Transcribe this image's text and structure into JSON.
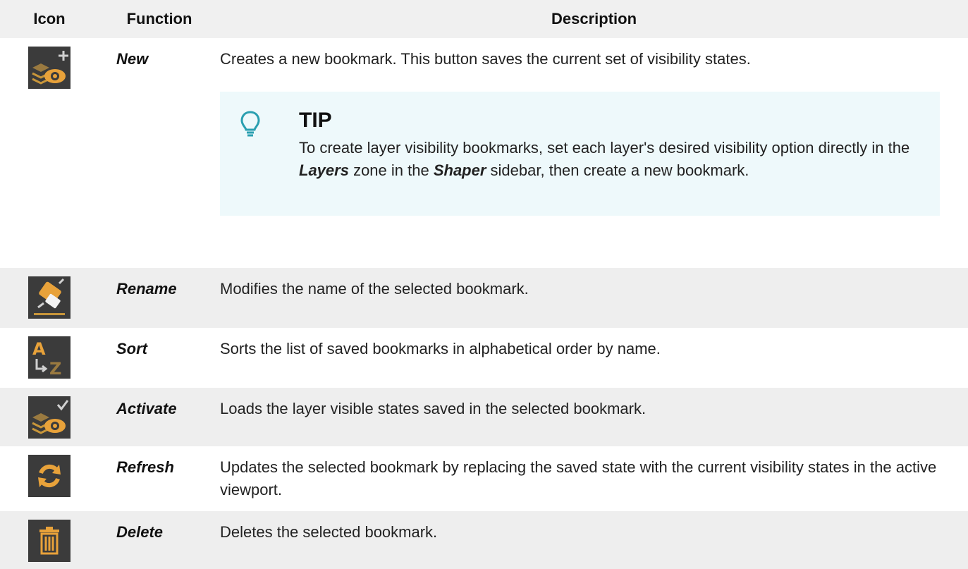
{
  "headers": {
    "icon": "Icon",
    "function": "Function",
    "description": "Description"
  },
  "colors": {
    "icon_bg": "#3b3b3b",
    "icon_accent": "#e0a030",
    "tip_bg": "#eef9fb",
    "tip_icon": "#2a9fb0"
  },
  "rows": [
    {
      "icon": "new-bookmark-icon",
      "function": "New",
      "description": "Creates a new bookmark. This button saves the current set of visibility states."
    },
    {
      "icon": "rename-icon",
      "function": "Rename",
      "description": "Modifies the name of the selected bookmark."
    },
    {
      "icon": "sort-az-icon",
      "function": "Sort",
      "description": "Sorts the list of saved bookmarks in alphabetical order by name."
    },
    {
      "icon": "activate-bookmark-icon",
      "function": "Activate",
      "description": "Loads the layer visible states saved in the selected bookmark."
    },
    {
      "icon": "refresh-icon",
      "function": "Refresh",
      "description": "Updates the selected bookmark by replacing the saved state with the current visibility states in the active viewport."
    },
    {
      "icon": "trash-icon",
      "function": "Delete",
      "description": "Deletes the selected bookmark."
    }
  ],
  "tip": {
    "icon": "lightbulb-icon",
    "title": "TIP",
    "text1": "To create layer visibility bookmarks, set each layer's desired visibility option directly in the ",
    "bold1": "Layers",
    "text2": " zone in the ",
    "bold2": "Shaper",
    "text3": " sidebar, then create a new bookmark."
  }
}
